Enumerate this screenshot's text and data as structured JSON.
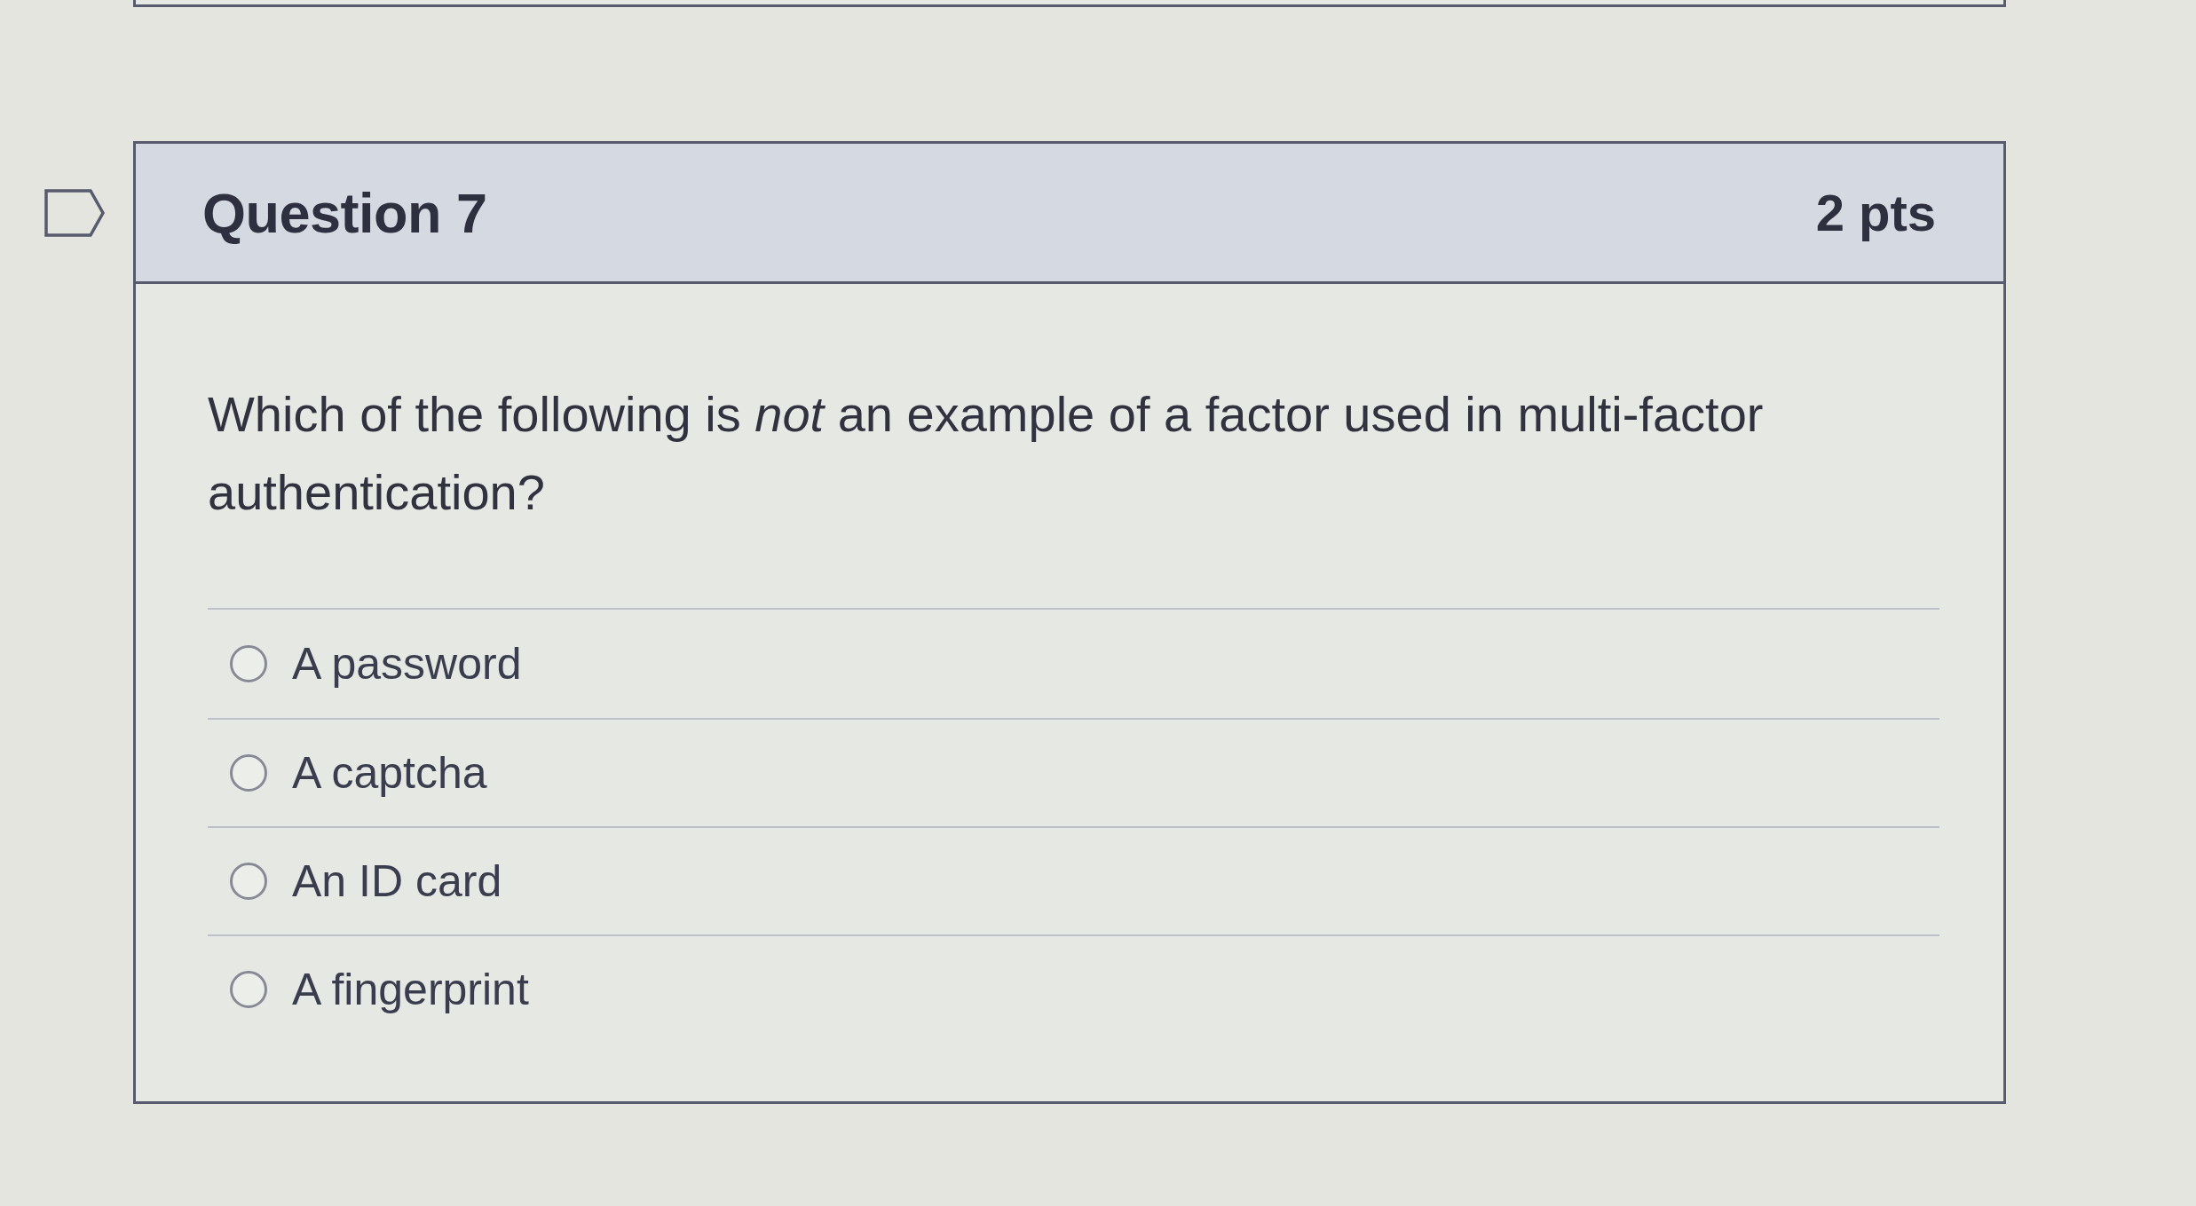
{
  "question": {
    "flagged": false,
    "title": "Question 7",
    "points": "2 pts",
    "text": "Which of the following is *not* an example of a factor used in multi-factor authentication?",
    "answers": [
      {
        "label": "A password",
        "selected": false
      },
      {
        "label": "A captcha",
        "selected": false
      },
      {
        "label": "An ID card",
        "selected": false
      },
      {
        "label": "A fingerprint",
        "selected": false
      }
    ]
  }
}
